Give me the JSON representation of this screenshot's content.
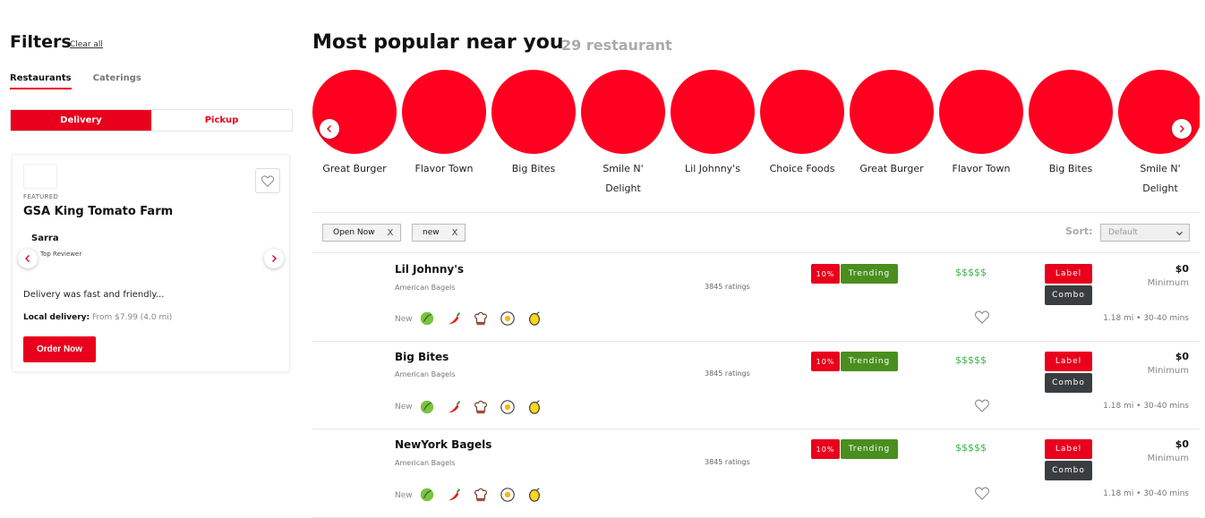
{
  "sidebar": {
    "title": "Filters",
    "clear_all": "Clear all",
    "tabs": [
      {
        "label": "Restaurants",
        "active": true
      },
      {
        "label": "Caterings",
        "active": false
      }
    ],
    "segment": [
      {
        "label": "Delivery",
        "active": true
      },
      {
        "label": "Pickup",
        "active": false
      }
    ],
    "card": {
      "featured": "FEATURED",
      "name": "GSA King Tomato Farm",
      "reviewer": "Sarra",
      "reviewer_role": "Top Reviewer",
      "review": "Delivery was fast and friendly...",
      "local_delivery_label": "Local delivery:",
      "local_delivery_value": "From $7.99 (4.0 mi)",
      "order_button": "Order Now"
    }
  },
  "main": {
    "title": "Most popular near you",
    "count": "29 restaurant",
    "carousel": [
      "Great Burger",
      "Flavor Town",
      "Big Bites",
      "Smile N' Delight",
      "Lil Johnny's",
      "Choice Foods",
      "Great Burger",
      "Flavor Town",
      "Big Bites",
      "Smile N' Delight"
    ],
    "chips": [
      {
        "label": "Open Now",
        "remove": "X"
      },
      {
        "label": "new",
        "remove": "X"
      }
    ],
    "sort": {
      "label": "Sort:",
      "value": "Default"
    },
    "restaurants": [
      {
        "name": "Lil Johnny's",
        "category": "American Bagels",
        "ratings": "3845 ratings",
        "discount": "10%",
        "trend": "Trending",
        "price": "$$$$$",
        "label": "Label",
        "combo": "Combo",
        "minimum_value": "$0",
        "minimum_label": "Minimum",
        "new": "New",
        "distance": "1.18 mi  •  30-40 mins"
      },
      {
        "name": "Big Bites",
        "category": "American Bagels",
        "ratings": "3845 ratings",
        "discount": "10%",
        "trend": "Trending",
        "price": "$$$$$",
        "label": "Label",
        "combo": "Combo",
        "minimum_value": "$0",
        "minimum_label": "Minimum",
        "new": "New",
        "distance": "1.18 mi  •  30-40 mins"
      },
      {
        "name": "NewYork Bagels",
        "category": "American Bagels",
        "ratings": "3845 ratings",
        "discount": "10%",
        "trend": "Trending",
        "price": "$$$$$",
        "label": "Label",
        "combo": "Combo",
        "minimum_value": "$0",
        "minimum_label": "Minimum",
        "new": "New",
        "distance": "1.18 mi  •  30-40 mins"
      }
    ],
    "row_icons": [
      "leaf-icon",
      "chili-icon",
      "chef-hat-icon",
      "egg-icon",
      "lemon-icon"
    ]
  },
  "colors": {
    "brand_red": "#e8001c",
    "trend_green": "#4a8f1e",
    "price_green": "#3bb34a",
    "combo_dark": "#3a3d40"
  }
}
